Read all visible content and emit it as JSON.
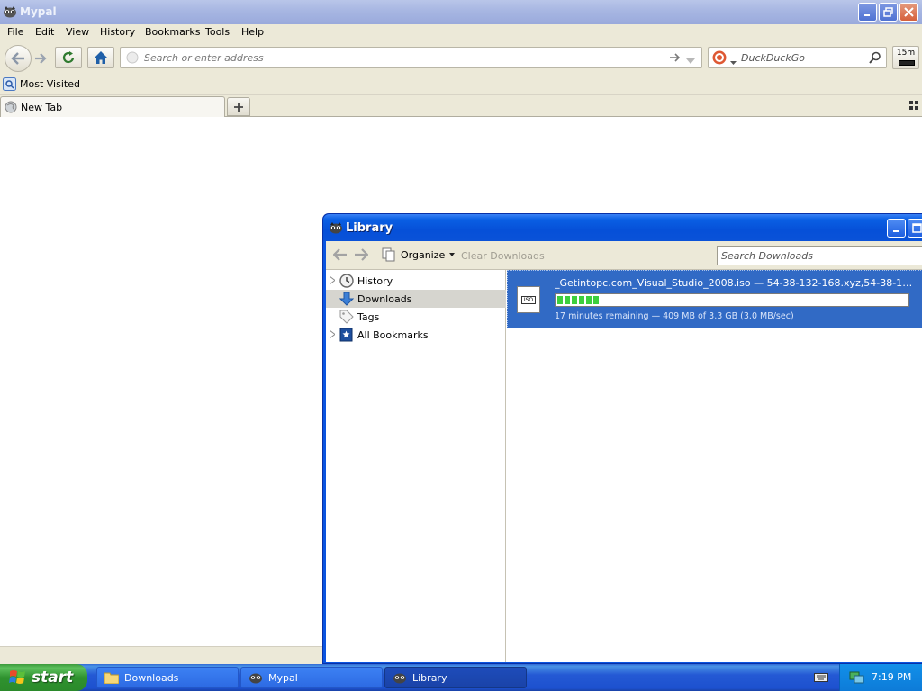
{
  "browser": {
    "title": "Mypal",
    "menu": [
      "File",
      "Edit",
      "View",
      "History",
      "Bookmarks",
      "Tools",
      "Help"
    ],
    "url_placeholder": "Search or enter address",
    "search_placeholder": "DuckDuckGo",
    "ext_button_label": "15m",
    "bookmarks": [
      {
        "label": "Most Visited"
      }
    ],
    "tabs": [
      {
        "label": "New Tab"
      }
    ],
    "colors": {
      "titlebar": "#a7b6e2",
      "chrome": "#ece9d8"
    }
  },
  "library": {
    "title": "Library",
    "toolbar": {
      "organize_label": "Organize",
      "clear_downloads_label": "Clear Downloads",
      "search_placeholder": "Search Downloads"
    },
    "sidebar": [
      {
        "label": "History",
        "icon": "clock-icon",
        "expandable": true
      },
      {
        "label": "Downloads",
        "icon": "download-arrow-icon",
        "expandable": false,
        "selected": true
      },
      {
        "label": "Tags",
        "icon": "tag-icon",
        "expandable": false
      },
      {
        "label": "All Bookmarks",
        "icon": "bookmark-star-icon",
        "expandable": true
      }
    ],
    "downloads": [
      {
        "name": "_Getintopc.com_Visual_Studio_2008.iso — 54-38-132-168.xyz,54-38-132-168....",
        "progress": 0.125,
        "status": "17 minutes remaining — 409 MB of 3.3 GB (3.0 MB/sec)"
      }
    ],
    "colors": {
      "selected_row": "#316ac5",
      "progress": "#3dcf3d"
    }
  },
  "taskbar": {
    "start_label": "start",
    "tasks": [
      {
        "label": "Downloads",
        "icon": "folder-icon",
        "active": false
      },
      {
        "label": "Mypal",
        "icon": "mypal-icon",
        "active": false
      },
      {
        "label": "Library",
        "icon": "mypal-icon",
        "active": true
      }
    ],
    "clock": "7:19 PM"
  }
}
